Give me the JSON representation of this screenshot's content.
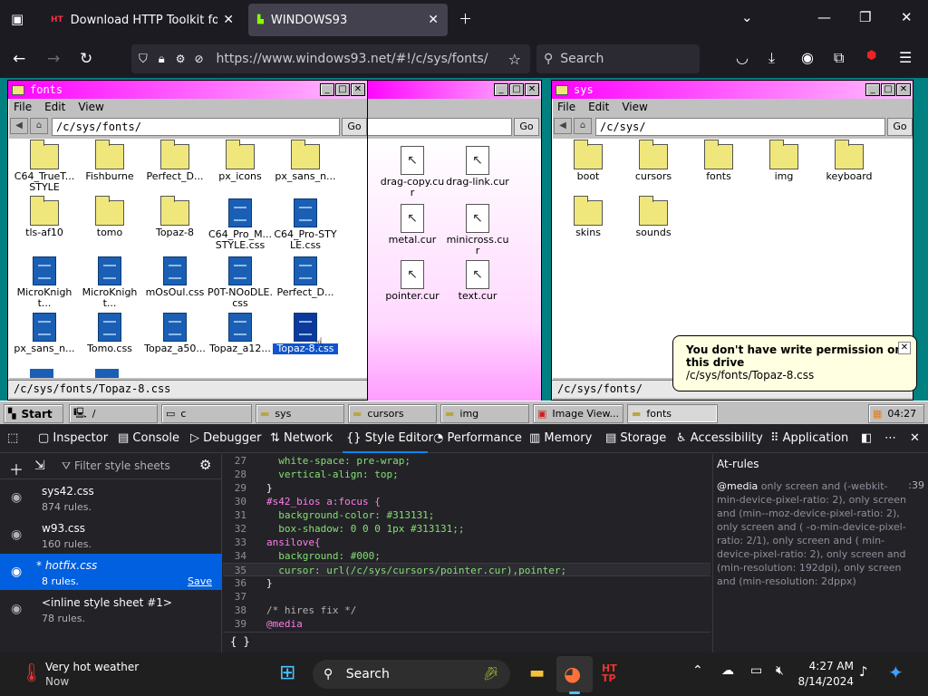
{
  "browser": {
    "tabs": [
      {
        "icon": "HTTP",
        "title": "Download HTTP Toolkit for Win"
      },
      {
        "icon": "93",
        "title": "WINDOWS93"
      }
    ],
    "url": "https://www.windows93.net/#!/c/sys/fonts/",
    "search_placeholder": "Search"
  },
  "windows": {
    "fonts": {
      "title": "fonts",
      "menu": [
        "File",
        "Edit",
        "View"
      ],
      "address": "/c/sys/fonts/",
      "go": "Go",
      "status": "/c/sys/fonts/Topaz-8.css",
      "items": [
        {
          "label": "C64_TrueT... STYLE",
          "type": "folder"
        },
        {
          "label": "Fishburne",
          "type": "folder"
        },
        {
          "label": "Perfect_D...",
          "type": "folder"
        },
        {
          "label": "px_icons",
          "type": "folder"
        },
        {
          "label": "px_sans_n...",
          "type": "folder"
        },
        {
          "label": "tls-af10",
          "type": "folder"
        },
        {
          "label": "tomo",
          "type": "folder"
        },
        {
          "label": "Topaz-8",
          "type": "folder"
        },
        {
          "label": "C64_Pro_M... STYLE.css",
          "type": "css"
        },
        {
          "label": "C64_Pro-STYLE.css",
          "type": "css"
        },
        {
          "label": "MicroKnight...",
          "type": "css"
        },
        {
          "label": "MicroKnight...",
          "type": "css"
        },
        {
          "label": "mOsOul.css",
          "type": "css"
        },
        {
          "label": "P0T-NOoDLE.css",
          "type": "css"
        },
        {
          "label": "Perfect_D...",
          "type": "css"
        },
        {
          "label": "px_sans_n...",
          "type": "css"
        },
        {
          "label": "Tomo.css",
          "type": "css"
        },
        {
          "label": "Topaz_a50...",
          "type": "css"
        },
        {
          "label": "Topaz_a12...",
          "type": "css"
        },
        {
          "label": "Topaz-8.css",
          "type": "css"
        }
      ]
    },
    "cursors": {
      "address_go": "Go",
      "items": [
        {
          "label": "drag-copy.cur"
        },
        {
          "label": "drag-link.cur"
        },
        {
          "label": "metal.cur"
        },
        {
          "label": "minicross.cur"
        },
        {
          "label": "pointer.cur"
        },
        {
          "label": "text.cur"
        }
      ]
    },
    "sys": {
      "title": "sys",
      "menu": [
        "File",
        "Edit",
        "View"
      ],
      "address": "/c/sys/",
      "go": "Go",
      "status": "/c/sys/fonts/",
      "items": [
        {
          "label": "boot"
        },
        {
          "label": "cursors"
        },
        {
          "label": "fonts"
        },
        {
          "label": "img"
        },
        {
          "label": "keyboard"
        },
        {
          "label": "skins"
        },
        {
          "label": "sounds"
        }
      ]
    }
  },
  "toast": {
    "title": "You don't have write permission on this drive",
    "path": "/c/sys/fonts/Topaz-8.css"
  },
  "w93taskbar": {
    "start": "Start",
    "items": [
      "/",
      "c",
      "sys",
      "cursors",
      "img",
      "Image View...",
      "fonts"
    ],
    "clock": "04:27"
  },
  "devtools": {
    "tabs": [
      "Inspector",
      "Console",
      "Debugger",
      "Network",
      "Style Editor",
      "Performance",
      "Memory",
      "Storage",
      "Accessibility",
      "Application"
    ],
    "filter_placeholder": "Filter style sheets",
    "sheets": [
      {
        "name": "sys42.css",
        "rules": "874 rules."
      },
      {
        "name": "w93.css",
        "rules": "160 rules."
      },
      {
        "name": "* hotfix.css",
        "rules": "8 rules.",
        "save": "Save"
      },
      {
        "name": "<inline style sheet #1>",
        "rules": "78 rules."
      }
    ],
    "code_lines": [
      {
        "n": "27",
        "text": "  white-space: pre-wrap;"
      },
      {
        "n": "28",
        "text": "  vertical-align: top;"
      },
      {
        "n": "29",
        "text": "}"
      },
      {
        "n": "30",
        "text": "#s42_bios a:focus {"
      },
      {
        "n": "31",
        "text": "  background-color: #313131;"
      },
      {
        "n": "32",
        "text": "  box-shadow: 0 0 0 1px #313131;;"
      },
      {
        "n": "33",
        "text": "ansilove{"
      },
      {
        "n": "34",
        "text": "  background: #000;"
      },
      {
        "n": "35",
        "text": "  cursor: url(/c/sys/cursors/pointer.cur),pointer;"
      },
      {
        "n": "36",
        "text": "}"
      },
      {
        "n": "37",
        "text": ""
      },
      {
        "n": "38",
        "text": "/* hires fix */"
      },
      {
        "n": "39",
        "text": "@media"
      }
    ],
    "editor_footer": "{ }",
    "at_rules": {
      "heading": "At-rules",
      "media_keyword": "@media",
      "media_text": "only screen and (-webkit-min-device-pixel-ratio: 2), only screen and (min--moz-device-pixel-ratio: 2), only screen and ( -o-min-device-pixel-ratio: 2/1), only screen and ( min-device-pixel-ratio: 2), only screen and (min-resolution: 192dpi), only screen and (min-resolution: 2dppx)",
      "line": ":39"
    }
  },
  "os_taskbar": {
    "weather_title": "Very hot weather",
    "weather_sub": "Now",
    "search": "Search",
    "time": "4:27 AM",
    "date": "8/14/2024"
  }
}
